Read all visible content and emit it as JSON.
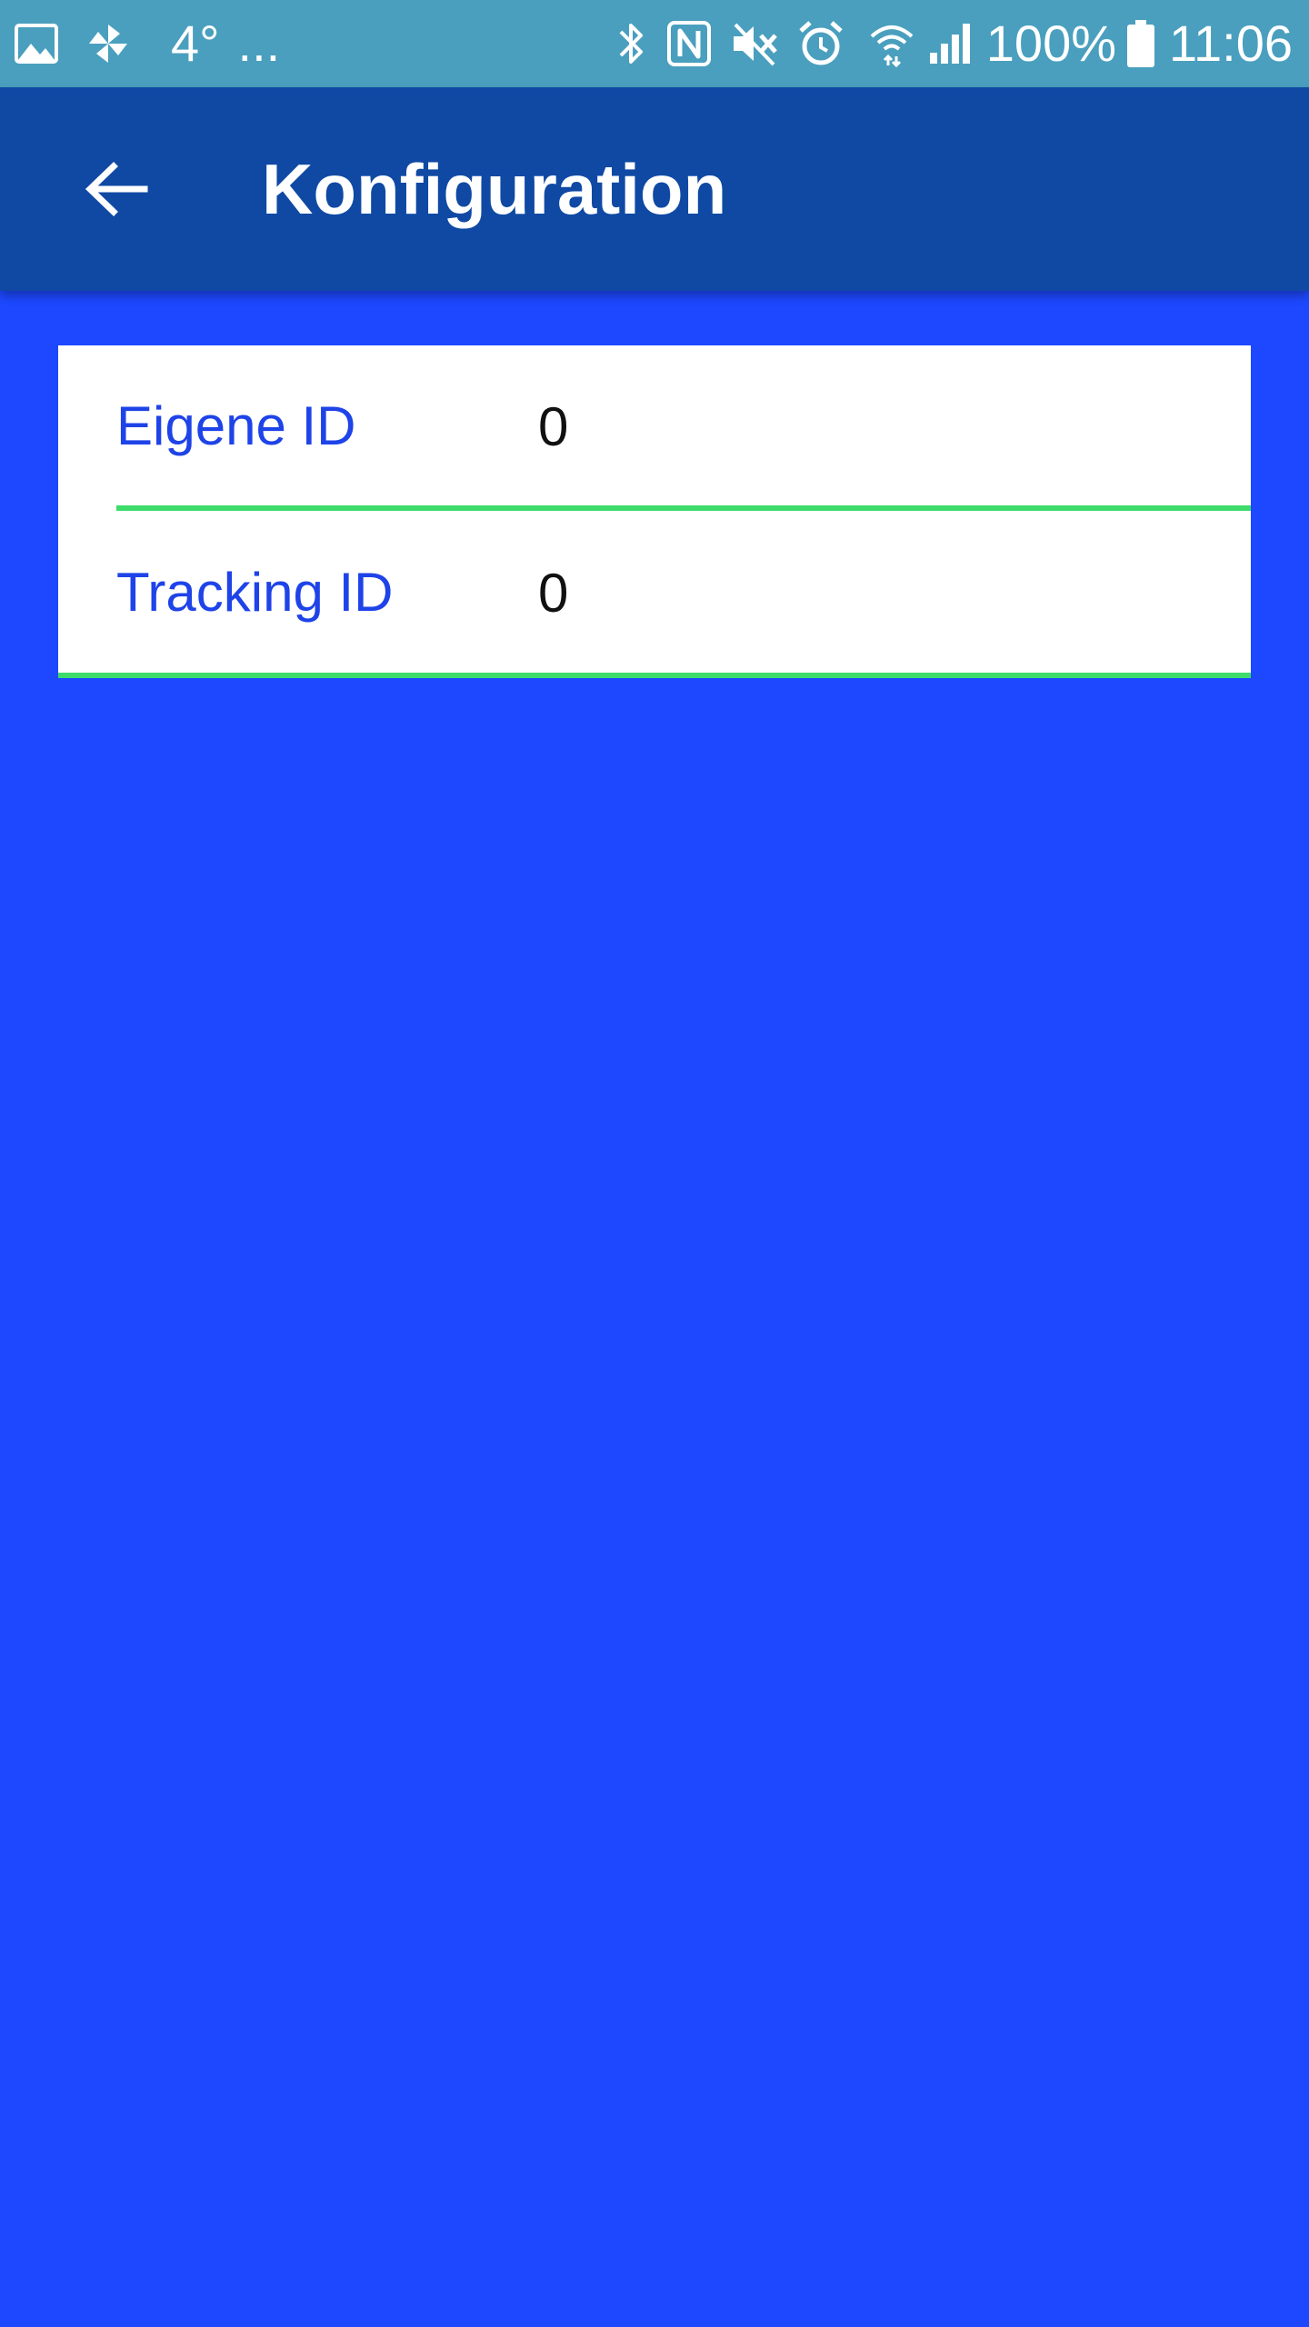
{
  "status_bar": {
    "left_icons": [
      "image-icon",
      "pinwheel-icon"
    ],
    "temperature": "4°",
    "overflow": "...",
    "right_icons": [
      "bluetooth-icon",
      "nfc-icon",
      "mute-icon",
      "alarm-icon",
      "wifi-icon",
      "signal-icon"
    ],
    "battery_percent": "100%",
    "time": "11:06",
    "background_color": "#4a9fbe"
  },
  "app_bar": {
    "back_icon": "arrow-back-icon",
    "title": "Konfiguration",
    "background_color": "#0f49a4"
  },
  "page": {
    "background_color": "#1d48ff"
  },
  "form": {
    "rows": [
      {
        "label": "Eigene ID",
        "value": "0"
      },
      {
        "label": "Tracking ID",
        "value": "0"
      }
    ],
    "label_color": "#1e43e8",
    "divider_color": "#3ddc6a"
  }
}
